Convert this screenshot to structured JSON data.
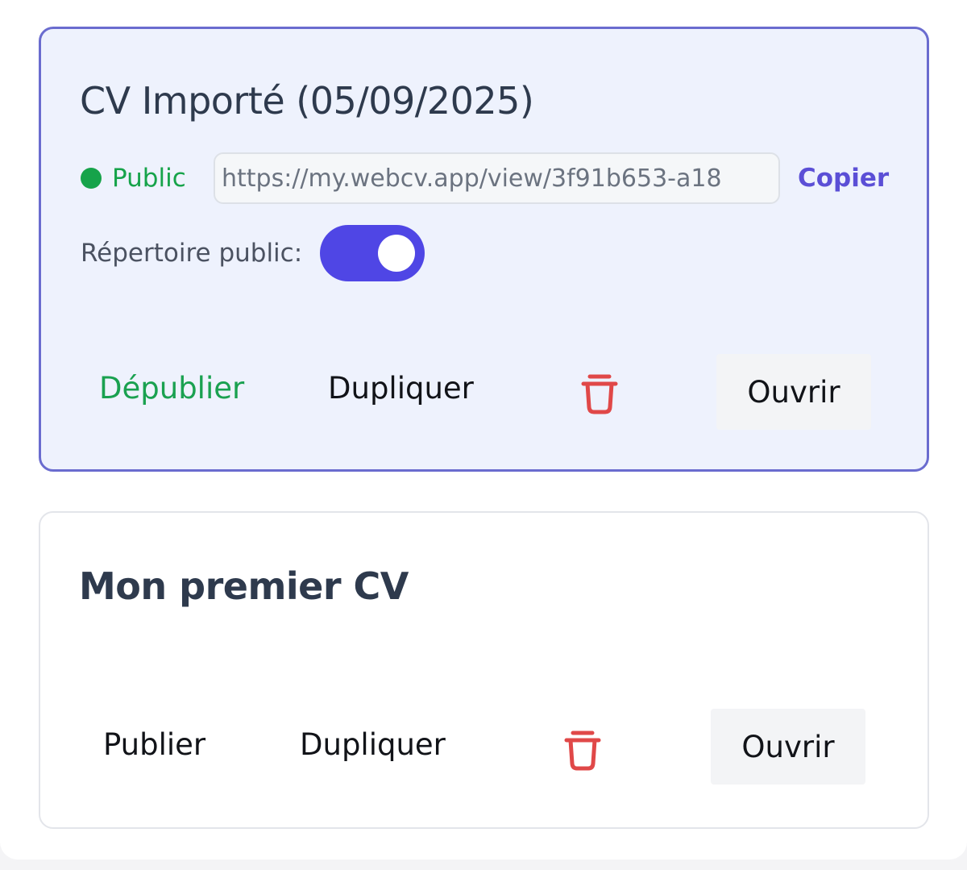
{
  "cvs": [
    {
      "title": "CV Importé (05/09/2025)",
      "status": "Public",
      "share_url": "https://my.webcv.app/view/3f91b653-a18",
      "copy_label": "Copier",
      "directory_label": "Répertoire public:",
      "directory_public": true,
      "publish_action": "Dépublier",
      "duplicate_action": "Dupliquer",
      "open_action": "Ouvrir",
      "selected": true
    },
    {
      "title": "Mon premier CV",
      "publish_action": "Publier",
      "duplicate_action": "Dupliquer",
      "open_action": "Ouvrir",
      "selected": false
    }
  ],
  "colors": {
    "accent": "#4f46e5",
    "public_green": "#16a34a",
    "delete_red": "#e04848",
    "selected_border": "#6a6ccf",
    "selected_bg": "#eef2fd"
  },
  "icons": {
    "status": "status-dot-icon",
    "delete": "trash-icon"
  }
}
